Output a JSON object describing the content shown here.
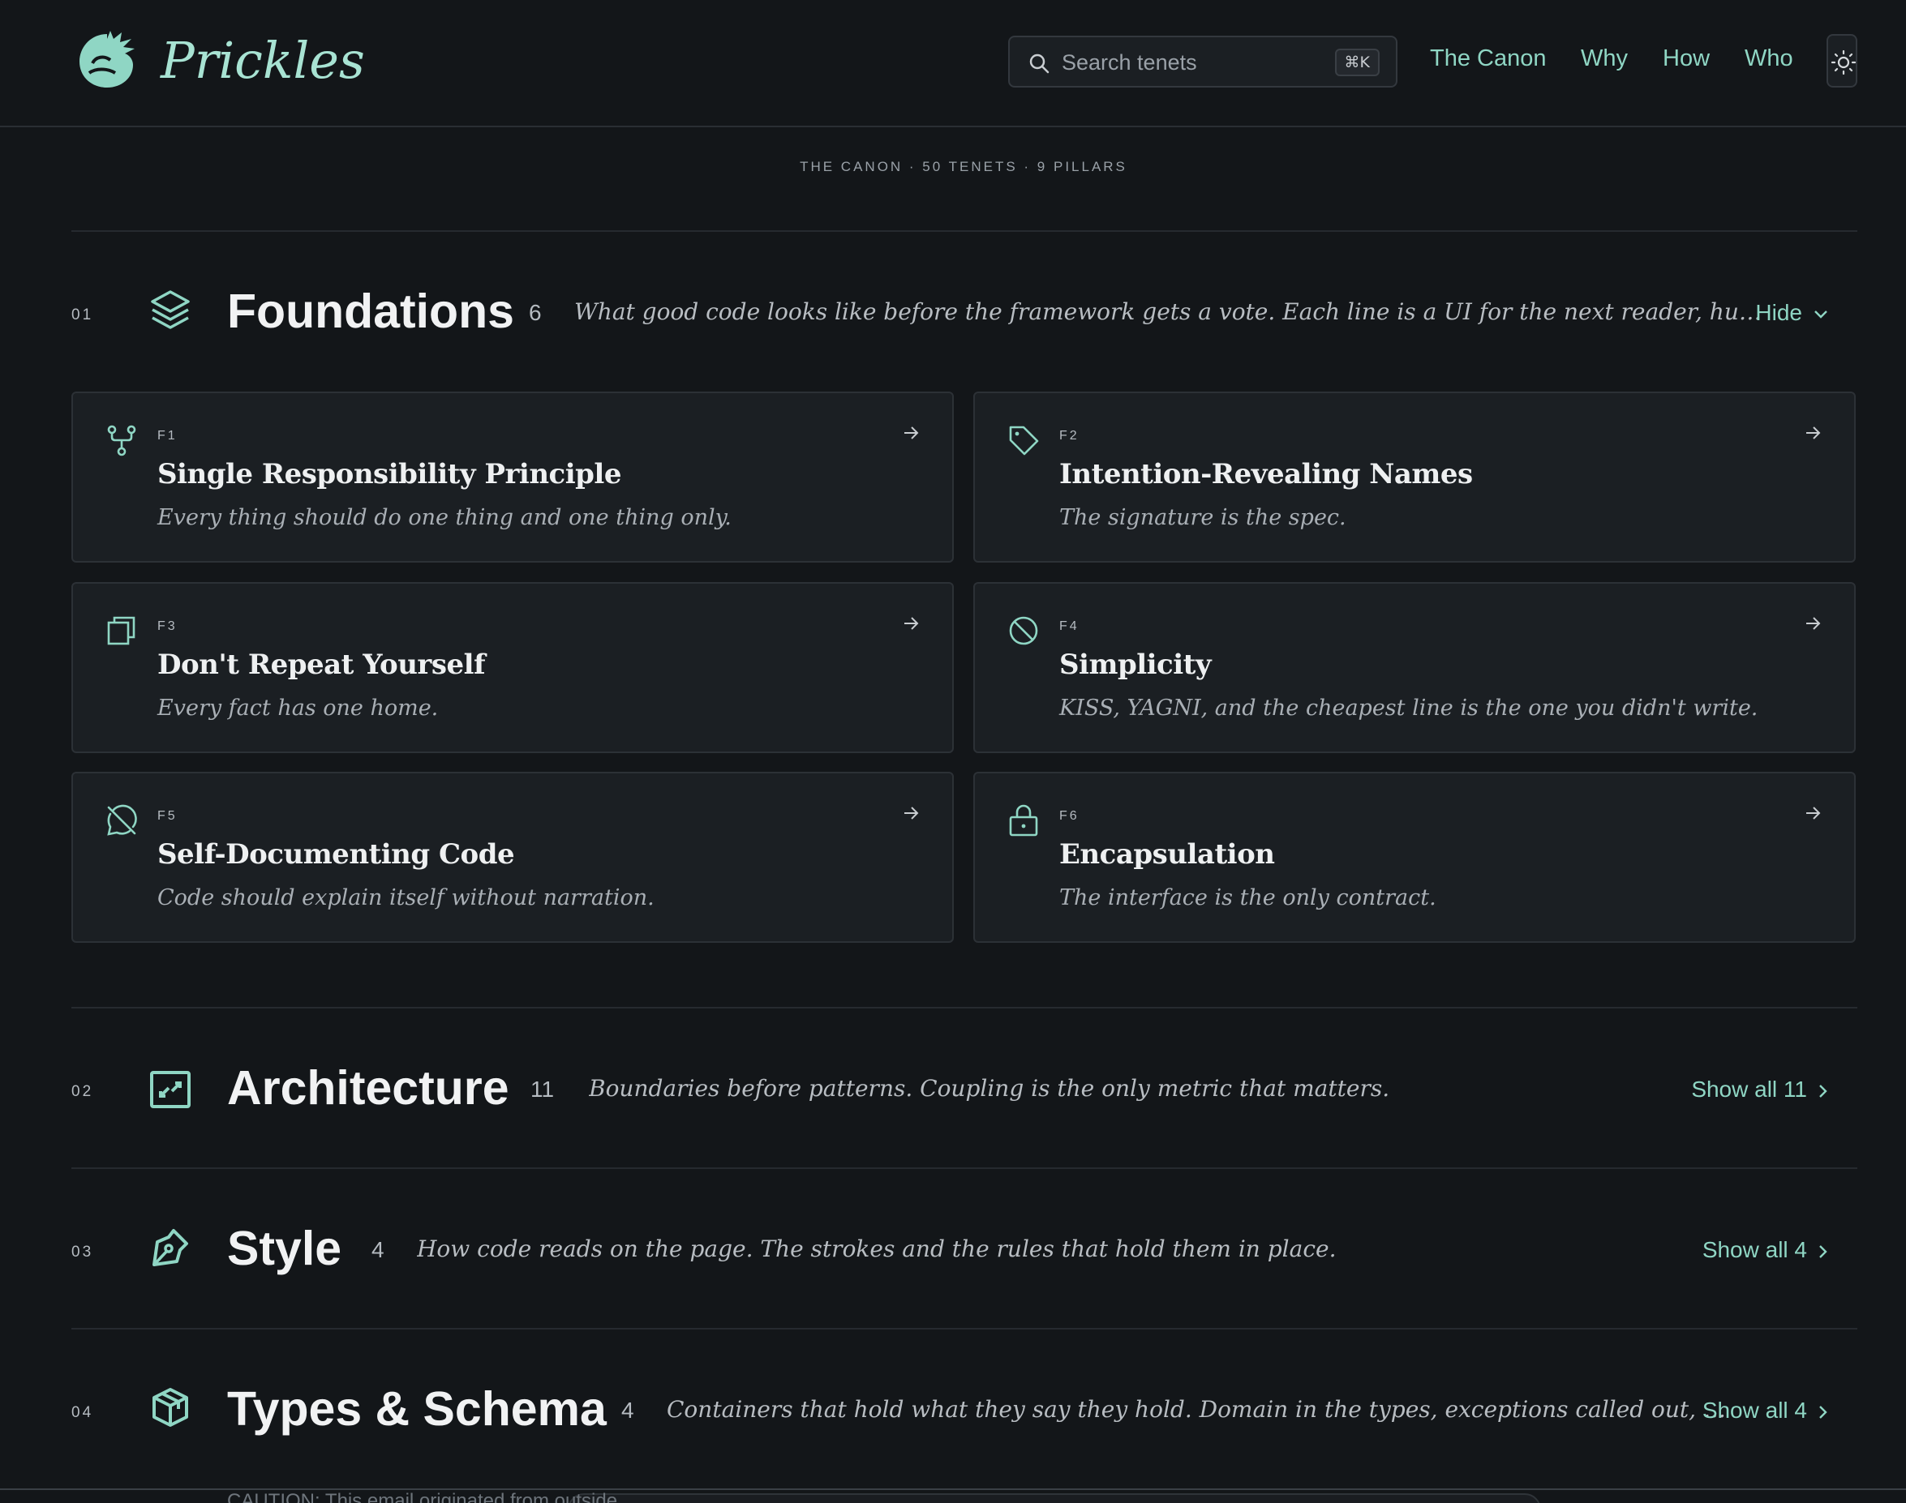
{
  "brand": {
    "name": "Prickles"
  },
  "search": {
    "placeholder": "Search tenets",
    "shortcut": "⌘K"
  },
  "nav": {
    "items": [
      "The Canon",
      "Why",
      "How",
      "Who"
    ]
  },
  "canon_meta": "THE CANON · 50 TENETS · 9 PILLARS",
  "pillars": [
    {
      "num": "01",
      "title": "Foundations",
      "count": "6",
      "desc": "What good code looks like before the framework gets a vote. Each line is a UI for the next reader, human or agent ...",
      "toggle": "Hide",
      "icon": "layers-icon",
      "tenets": [
        {
          "code": "F1",
          "title": "Single Responsibility Principle",
          "subtitle": "Every thing should do one thing and one thing only.",
          "icon": "fork-icon"
        },
        {
          "code": "F2",
          "title": "Intention-Revealing Names",
          "subtitle": "The signature is the spec.",
          "icon": "tag-icon"
        },
        {
          "code": "F3",
          "title": "Don't Repeat Yourself",
          "subtitle": "Every fact has one home.",
          "icon": "copy-icon"
        },
        {
          "code": "F4",
          "title": "Simplicity",
          "subtitle": "KISS, YAGNI, and the cheapest line is the one you didn't write.",
          "icon": "ban-icon"
        },
        {
          "code": "F5",
          "title": "Self-Documenting Code",
          "subtitle": "Code should explain itself without narration.",
          "icon": "message-off-icon"
        },
        {
          "code": "F6",
          "title": "Encapsulation",
          "subtitle": "The interface is the only contract.",
          "icon": "lock-icon"
        }
      ]
    },
    {
      "num": "02",
      "title": "Architecture",
      "count": "11",
      "desc": "Boundaries before patterns. Coupling is the only metric that matters.",
      "toggle": "Show all 11",
      "icon": "frame-icon"
    },
    {
      "num": "03",
      "title": "Style",
      "count": "4",
      "desc": "How code reads on the page. The strokes and the rules that hold them in place.",
      "toggle": "Show all 4",
      "icon": "pen-icon"
    },
    {
      "num": "04",
      "title": "Types & Schema",
      "count": "4",
      "desc": "Containers that hold what they say they hold. Domain in the types, exceptions called out, casts rep...",
      "toggle": "Show all 4",
      "icon": "package-icon"
    }
  ],
  "toast": {
    "text": "CAUTION: This email originated from outside"
  },
  "colors": {
    "background": "#131619",
    "card": "#1b1f23",
    "accent": "#8fd6c4"
  }
}
